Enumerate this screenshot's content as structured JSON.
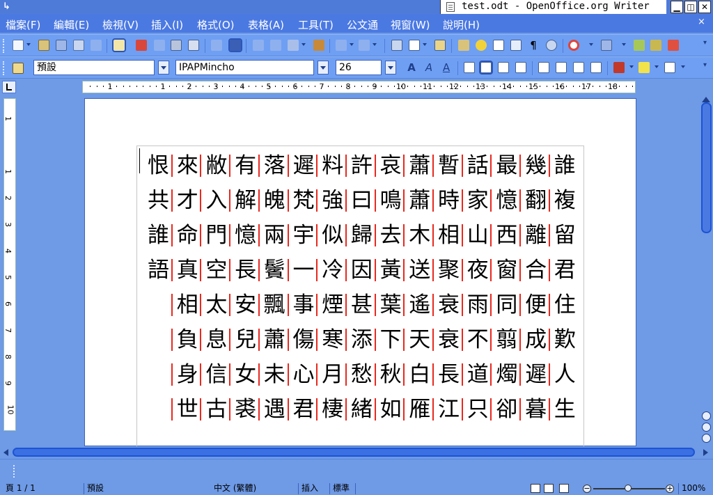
{
  "window": {
    "title": "test.odt - OpenOffice.org Writer",
    "buttons": [
      "minimize",
      "maximize",
      "close"
    ]
  },
  "menu": {
    "items": [
      "檔案(F)",
      "編輯(E)",
      "檢視(V)",
      "插入(I)",
      "格式(O)",
      "表格(A)",
      "工具(T)",
      "公文通",
      "視窗(W)",
      "說明(H)"
    ],
    "close_doc": "×"
  },
  "toolbar1": {
    "icons": [
      "new-icon",
      "open-icon",
      "save-icon",
      "email-icon",
      "edit-file-icon",
      "edit-mode-icon",
      "export-pdf-icon",
      "print-direct-icon",
      "print-icon",
      "print-preview-icon",
      "spellcheck-icon",
      "autospell-icon",
      "cut-icon",
      "copy-icon",
      "paste-icon",
      "clone-format-icon",
      "undo-icon",
      "redo-icon",
      "navigator-icon",
      "table-icon",
      "draw-icon",
      "gallery-icon",
      "star-icon",
      "data-sources-icon",
      "nonprinting-chars-icon",
      "pilcrow-icon",
      "zoom-icon",
      "help-icon",
      "save-as-icon",
      "extra-icon-1",
      "extra-icon-2",
      "extra-icon-3"
    ]
  },
  "toolbar2": {
    "style_value": "預設",
    "font_value": "IPAPMincho",
    "size_value": "26",
    "icons": [
      "outline-font-icon",
      "italic-font-icon",
      "shadow-font-icon",
      "align-left-icon",
      "align-center-icon",
      "align-right-icon",
      "justify-icon",
      "numbering-icon",
      "bullets-icon",
      "decrease-indent-icon",
      "increase-indent-icon",
      "font-color-icon",
      "highlight-icon",
      "background-color-icon"
    ]
  },
  "ruler": {
    "labels": [
      "1",
      "1",
      "2",
      "3",
      "4",
      "5",
      "6",
      "7",
      "8",
      "9",
      "10",
      "11",
      "12",
      "13",
      "14",
      "15",
      "16",
      "17",
      "18"
    ],
    "vlabels": [
      "1",
      "1",
      "2",
      "3",
      "4",
      "5",
      "6",
      "7",
      "8",
      "9",
      "10"
    ]
  },
  "document": {
    "rows": [
      [
        "恨",
        "來",
        "敝",
        "有",
        "落",
        "遲",
        "料",
        "許",
        "哀",
        "蕭",
        "暫",
        "話",
        "最",
        "幾",
        "誰"
      ],
      [
        "共",
        "才",
        "入",
        "解",
        "魄",
        "梵",
        "強",
        "曰",
        "鳴",
        "蕭",
        "時",
        "家",
        "憶",
        "翻",
        "複"
      ],
      [
        "誰",
        "命",
        "門",
        "憶",
        "兩",
        "宇",
        "似",
        "歸",
        "去",
        "木",
        "相",
        "山",
        "西",
        "離",
        "留"
      ],
      [
        "語",
        "真",
        "空",
        "長",
        "鬢",
        "一",
        "冷",
        "因",
        "黃",
        "送",
        "聚",
        "夜",
        "窗",
        "合",
        "君"
      ],
      [
        "",
        "相",
        "太",
        "安",
        "飄",
        "事",
        "煙",
        "甚",
        "葉",
        "遙",
        "衰",
        "雨",
        "同",
        "便",
        "住"
      ],
      [
        "",
        "負",
        "息",
        "兒",
        "蕭",
        "傷",
        "寒",
        "添",
        "下",
        "天",
        "衰",
        "不",
        "翦",
        "成",
        "歎"
      ],
      [
        "",
        "身",
        "信",
        "女",
        "未",
        "心",
        "月",
        "愁",
        "秋",
        "白",
        "長",
        "道",
        "燭",
        "遲",
        "人"
      ],
      [
        "",
        "世",
        "古",
        "裘",
        "遇",
        "君",
        "棲",
        "緒",
        "如",
        "雁",
        "江",
        "只",
        "卻",
        "暮",
        "生"
      ]
    ],
    "separator_color": "#e8281e"
  },
  "status": {
    "page": "頁 1 / 1",
    "style": "預設",
    "language": "中文 (繁體)",
    "insert_mode": "插入",
    "selection_mode": "標準",
    "zoom": "100%",
    "zoom_level": 100
  },
  "colors": {
    "accent": "#4b79e2",
    "toolbar_bg": "#6f9ff3",
    "workspace_bg": "#6e9ae6",
    "separator": "#e8281e"
  }
}
